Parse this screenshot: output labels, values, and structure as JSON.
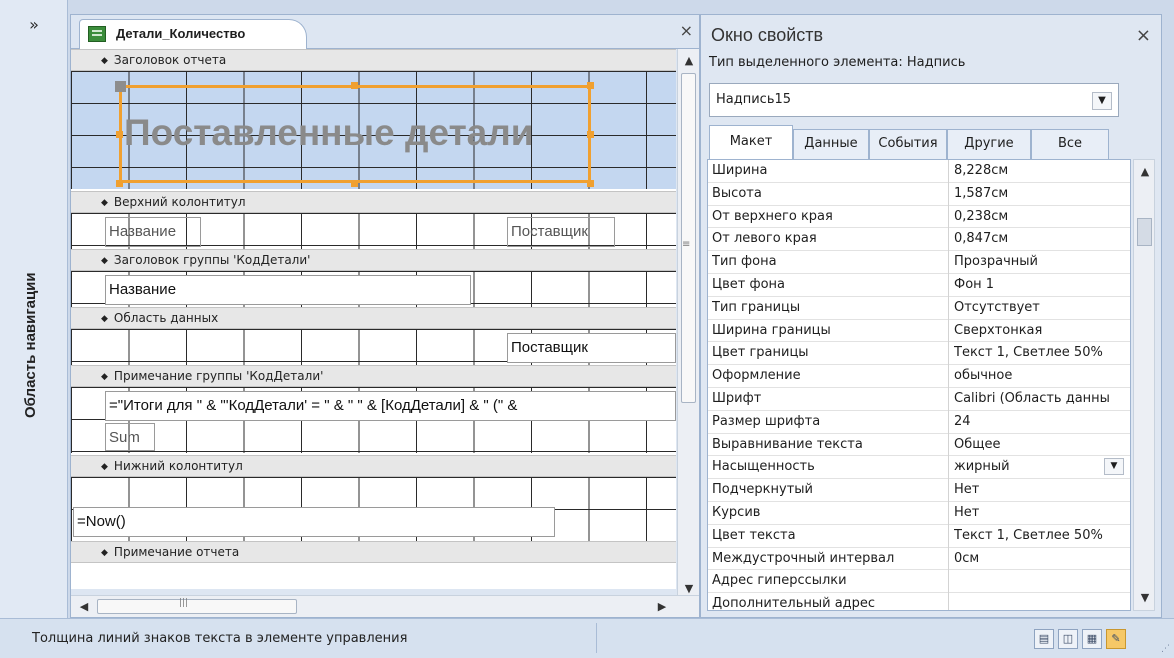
{
  "nav": {
    "collapse": "»",
    "title": "Область навигации"
  },
  "document": {
    "tab_title": "Детали_Количество",
    "close": "×",
    "sections": {
      "report_header": "Заголовок отчета",
      "page_header": "Верхний колонтитул",
      "group_header": "Заголовок группы 'КодДетали'",
      "detail": "Область данных",
      "group_footer": "Примечание группы 'КодДетали'",
      "page_footer": "Нижний колонтитул",
      "report_footer": "Примечание отчета"
    },
    "controls": {
      "title": "Поставленные детали",
      "ph_name": "Название",
      "ph_supplier": "Поставщик",
      "gh_name": "Название",
      "detail_supplier": "Поставщик",
      "gf_expr": "=\"Итоги для \" & \"'КодДетали' = \" & \" \" & [КодДетали] & \" (\" &",
      "gf_sum": "Sum",
      "pf_now": "=Now()"
    }
  },
  "properties": {
    "title": "Окно свойств",
    "close": "×",
    "selection_type": "Тип выделенного элемента:  Надпись",
    "selected": "Надпись15",
    "tabs": [
      "Макет",
      "Данные",
      "События",
      "Другие",
      "Все"
    ],
    "rows": [
      {
        "name": "Ширина",
        "value": "8,228см"
      },
      {
        "name": "Высота",
        "value": "1,587см"
      },
      {
        "name": "От верхнего края",
        "value": "0,238см"
      },
      {
        "name": "От левого края",
        "value": "0,847см"
      },
      {
        "name": "Тип фона",
        "value": "Прозрачный"
      },
      {
        "name": "Цвет фона",
        "value": "Фон 1"
      },
      {
        "name": "Тип границы",
        "value": "Отсутствует"
      },
      {
        "name": "Ширина границы",
        "value": "Сверхтонкая"
      },
      {
        "name": "Цвет границы",
        "value": "Текст 1, Светлее 50%"
      },
      {
        "name": "Оформление",
        "value": "обычное"
      },
      {
        "name": "Шрифт",
        "value": "Calibri (Область данны"
      },
      {
        "name": "Размер шрифта",
        "value": "24"
      },
      {
        "name": "Выравнивание текста",
        "value": "Общее"
      },
      {
        "name": "Насыщенность",
        "value": "жирный"
      },
      {
        "name": "Подчеркнутый",
        "value": "Нет"
      },
      {
        "name": "Курсив",
        "value": "Нет"
      },
      {
        "name": "Цвет текста",
        "value": "Текст 1, Светлее 50%"
      },
      {
        "name": "Междустрочный интервал",
        "value": "0см"
      },
      {
        "name": "Адрес гиперссылки",
        "value": ""
      },
      {
        "name": "Дополнительный адрес",
        "value": ""
      }
    ]
  },
  "status": {
    "message": "Толщина линий знаков текста в элементе управления"
  },
  "colors": {
    "selection": "#f0a030",
    "band": "#e7e7e7",
    "header_bg": "#c4d7f0",
    "chrome": "#dde6f2"
  }
}
